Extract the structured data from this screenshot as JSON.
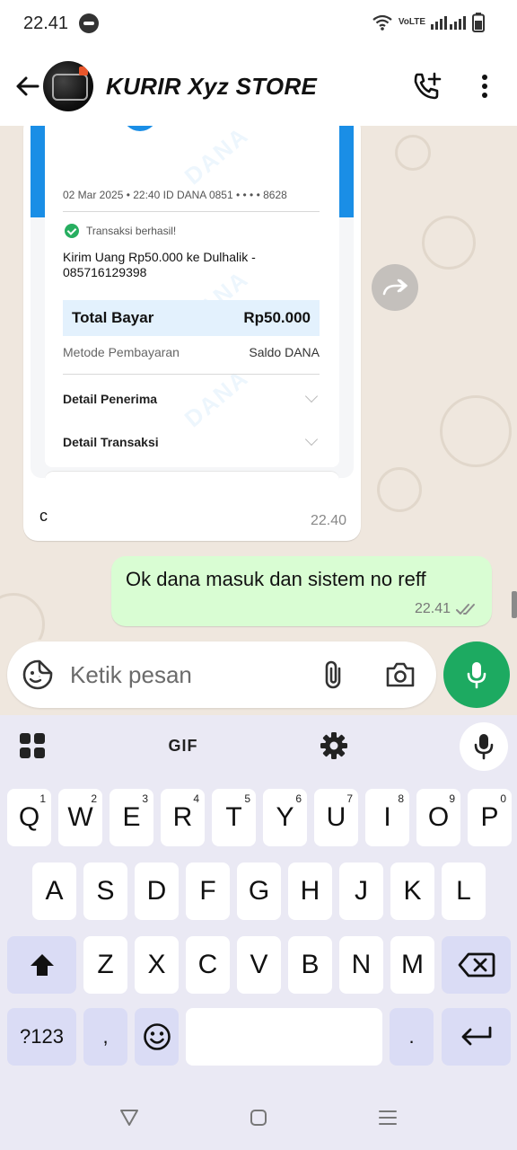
{
  "status_bar": {
    "time": "22.41",
    "network_label": "VoLTE"
  },
  "header": {
    "title": "KURIR Xyz STORE"
  },
  "incoming_message": {
    "receipt": {
      "date_line": "02 Mar 2025  •  22:40 ID DANA 0851 •  •  •  • 8628",
      "status": "Transaksi berhasil!",
      "description": "Kirim Uang Rp50.000 ke Dulhalik - 085716129398",
      "total_label": "Total Bayar",
      "total_value": "Rp50.000",
      "method_label": "Metode Pembayaran",
      "method_value": "Saldo DANA",
      "detail_receiver": "Detail Penerima",
      "detail_transaction": "Detail Transaksi",
      "watermark": "DANA"
    },
    "caption": "c",
    "time": "22.40"
  },
  "outgoing_message": {
    "text": "Ok dana masuk dan sistem no reff",
    "time": "22.41"
  },
  "input": {
    "placeholder": "Ketik pesan"
  },
  "keyboard": {
    "gif_label": "GIF",
    "row1": [
      {
        "key": "Q",
        "hint": "1"
      },
      {
        "key": "W",
        "hint": "2"
      },
      {
        "key": "E",
        "hint": "3"
      },
      {
        "key": "R",
        "hint": "4"
      },
      {
        "key": "T",
        "hint": "5"
      },
      {
        "key": "Y",
        "hint": "6"
      },
      {
        "key": "U",
        "hint": "7"
      },
      {
        "key": "I",
        "hint": "8"
      },
      {
        "key": "O",
        "hint": "9"
      },
      {
        "key": "P",
        "hint": "0"
      }
    ],
    "row2": [
      "A",
      "S",
      "D",
      "F",
      "G",
      "H",
      "J",
      "K",
      "L"
    ],
    "row3": [
      "Z",
      "X",
      "C",
      "V",
      "B",
      "N",
      "M"
    ],
    "symbols_label": "?123",
    "comma_label": ",",
    "period_label": "."
  },
  "colors": {
    "accent_green": "#1daa61",
    "outgoing_bubble": "#d9fdd3",
    "dana_blue": "#1a8ee6",
    "chat_background": "#efe7de",
    "keyboard_background": "#eae9f4"
  }
}
